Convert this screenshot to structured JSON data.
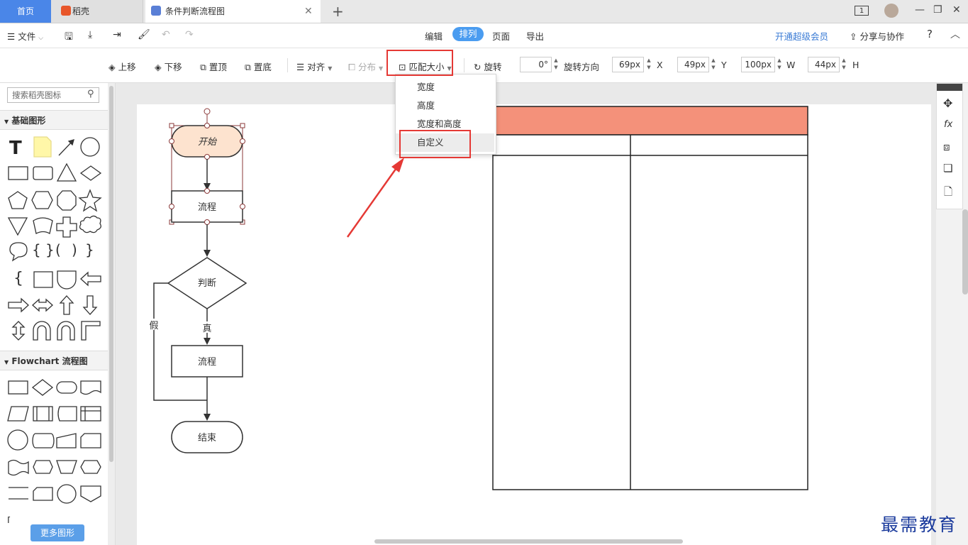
{
  "tabs": {
    "home": "首页",
    "daoke": "稻壳",
    "document": "条件判断流程图"
  },
  "window": {
    "page_indicator": "1"
  },
  "menubar": {
    "file": "文件",
    "items": [
      "编辑",
      "排列",
      "页面",
      "导出"
    ],
    "vip": "开通超级会员",
    "share": "分享与协作",
    "help": "?"
  },
  "toolbar": {
    "move_up": "上移",
    "move_down": "下移",
    "to_top": "置顶",
    "to_bottom": "置底",
    "align": "对齐",
    "distribute": "分布",
    "match_size": "匹配大小",
    "rotate": "旋转",
    "rotation_value": "0°",
    "rotation_dir": "旋转方向",
    "x_value": "69px",
    "x_label": "X",
    "y_value": "49px",
    "y_label": "Y",
    "w_value": "100px",
    "w_label": "W",
    "h_value": "44px",
    "h_label": "H"
  },
  "dropdown": {
    "items": [
      "宽度",
      "高度",
      "宽度和高度",
      "自定义"
    ]
  },
  "leftpanel": {
    "search_placeholder": "搜索稻壳图标",
    "section_basic": "基础图形",
    "section_flowchart": "Flowchart 流程图",
    "more_shapes": "更多图形"
  },
  "flowchart": {
    "start": "开始",
    "process1": "流程",
    "decision": "判断",
    "true_label": "真",
    "false_label": "假",
    "process2": "流程",
    "end": "结束"
  },
  "colors": {
    "accent": "#4a86e8",
    "highlight": "#e53935",
    "table_header": "#f4917a",
    "start_fill": "#fde3cf"
  },
  "watermark": "最需教育"
}
